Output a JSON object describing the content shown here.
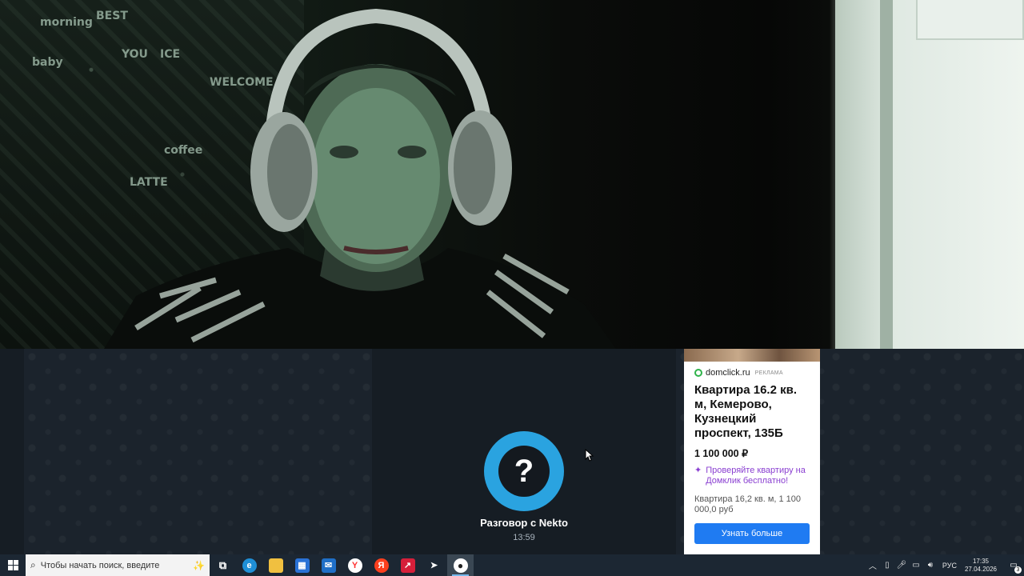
{
  "chat": {
    "partner_name": "Разговор с Nekto",
    "duration": "13:59",
    "avatar_symbol": "?",
    "accent_color": "#2aa3e0"
  },
  "ad": {
    "domain": "domclick.ru",
    "tag": "РЕКЛАМА",
    "title": "Квартира 16.2 кв. м, Кемерово, Кузнецкий проспект, 135Б",
    "price": "1 100 000 ₽",
    "promo": "Проверяйте квартиру на Домклик бесплатно!",
    "description": "Квартира 16,2 кв. м, 1 100 000,0 руб",
    "button_label": "Узнать больше",
    "button_color": "#1f7bf2",
    "promo_color": "#8a3fd1"
  },
  "video": {
    "background_text": [
      "BEST",
      "YOU",
      "WELCOME",
      "LATTE",
      "coffee",
      "ICE",
      "morning",
      "baby"
    ]
  },
  "taskbar": {
    "search_placeholder": "Чтобы начать поиск, введите",
    "apps": [
      {
        "name": "task-view-icon",
        "glyph": "⧉",
        "color": "transparent"
      },
      {
        "name": "edge-icon",
        "glyph": "e",
        "color": "#1f8fd6"
      },
      {
        "name": "file-explorer-icon",
        "glyph": "▬",
        "color": "#f0c040"
      },
      {
        "name": "store-icon",
        "glyph": "▦",
        "color": "#2a72d6"
      },
      {
        "name": "mail-icon",
        "glyph": "✉",
        "color": "#1f6fc7"
      },
      {
        "name": "yandex-browser-icon",
        "glyph": "Y",
        "color": "#ff3333"
      },
      {
        "name": "yandex-icon",
        "glyph": "Я",
        "color": "#fc3f1d"
      },
      {
        "name": "stocks-icon",
        "glyph": "↗",
        "color": "#d61f3a"
      },
      {
        "name": "telegram-icon",
        "glyph": "➤",
        "color": "#2a3440"
      },
      {
        "name": "obs-icon",
        "glyph": "●",
        "color": "#3a4753"
      }
    ],
    "language": "РУС",
    "time": "17:35",
    "date": "27.04.2026",
    "notification_count": "3"
  }
}
